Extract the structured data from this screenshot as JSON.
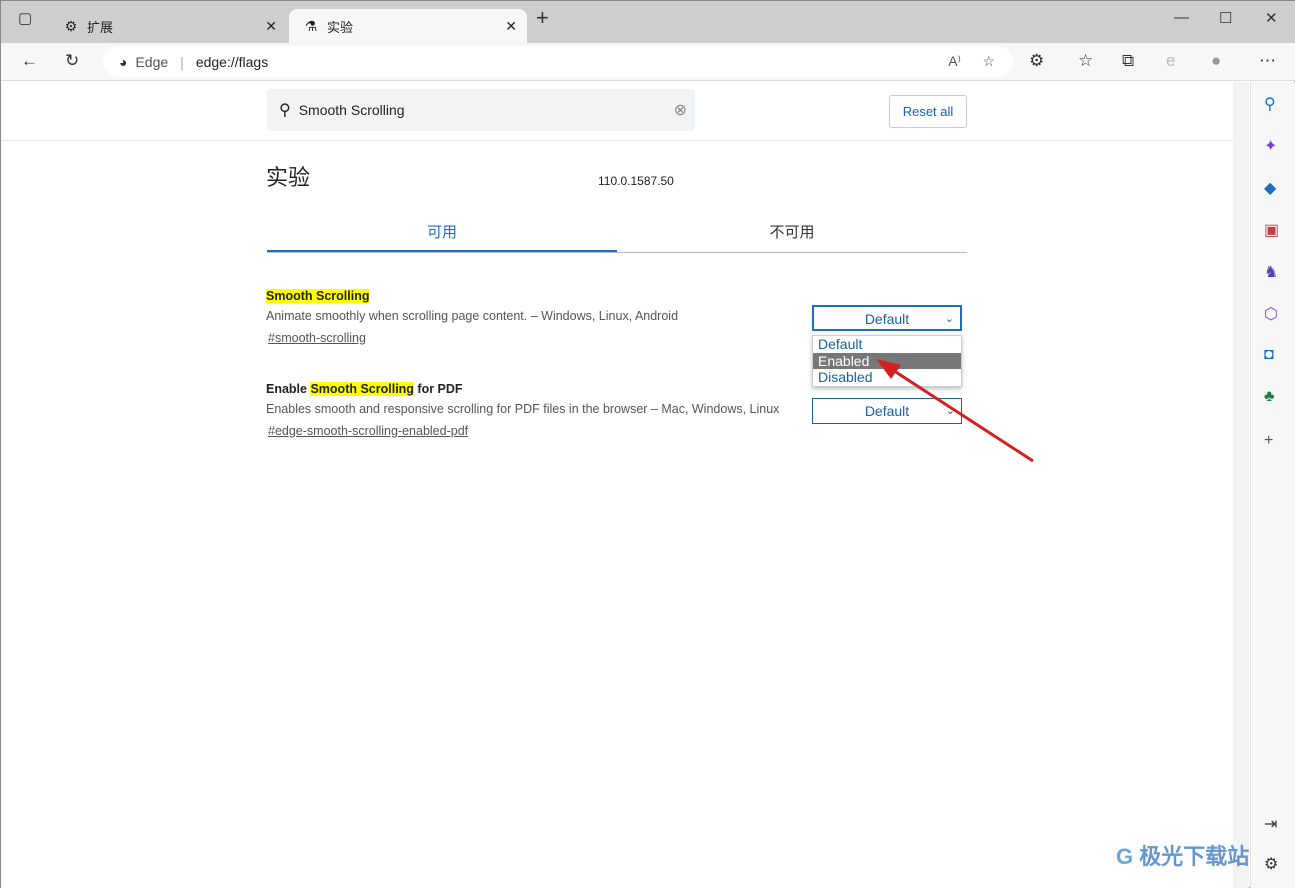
{
  "tabs": [
    {
      "label": "扩展",
      "icon": "puzzle-icon"
    },
    {
      "label": "实验",
      "icon": "flask-icon",
      "active": true
    }
  ],
  "address": {
    "site": "Edge",
    "url": "edge://flags"
  },
  "search": {
    "value": "Smooth Scrolling"
  },
  "reset_label": "Reset all",
  "page_title": "实验",
  "version": "110.0.1587.50",
  "flag_tabs": [
    "可用",
    "不可用"
  ],
  "flags": [
    {
      "name_pre": "",
      "name_hl": "Smooth Scrolling",
      "name_post": "",
      "desc": "Animate smoothly when scrolling page content. – Windows, Linux, Android",
      "link": "#smooth-scrolling",
      "value": "Default"
    },
    {
      "name_pre": "Enable ",
      "name_hl": "Smooth Scrolling",
      "name_post": " for PDF",
      "desc": "Enables smooth and responsive scrolling for PDF files in the browser – Mac, Windows, Linux",
      "link": "#edge-smooth-scrolling-enabled-pdf",
      "value": "Default"
    }
  ],
  "dropdown_options": [
    "Default",
    "Enabled",
    "Disabled"
  ],
  "dropdown_highlighted": "Enabled",
  "watermark": "极光下载站",
  "colors": {
    "accent": "#1a6fc4",
    "highlight": "#ffff00",
    "arrow": "#d42020"
  }
}
